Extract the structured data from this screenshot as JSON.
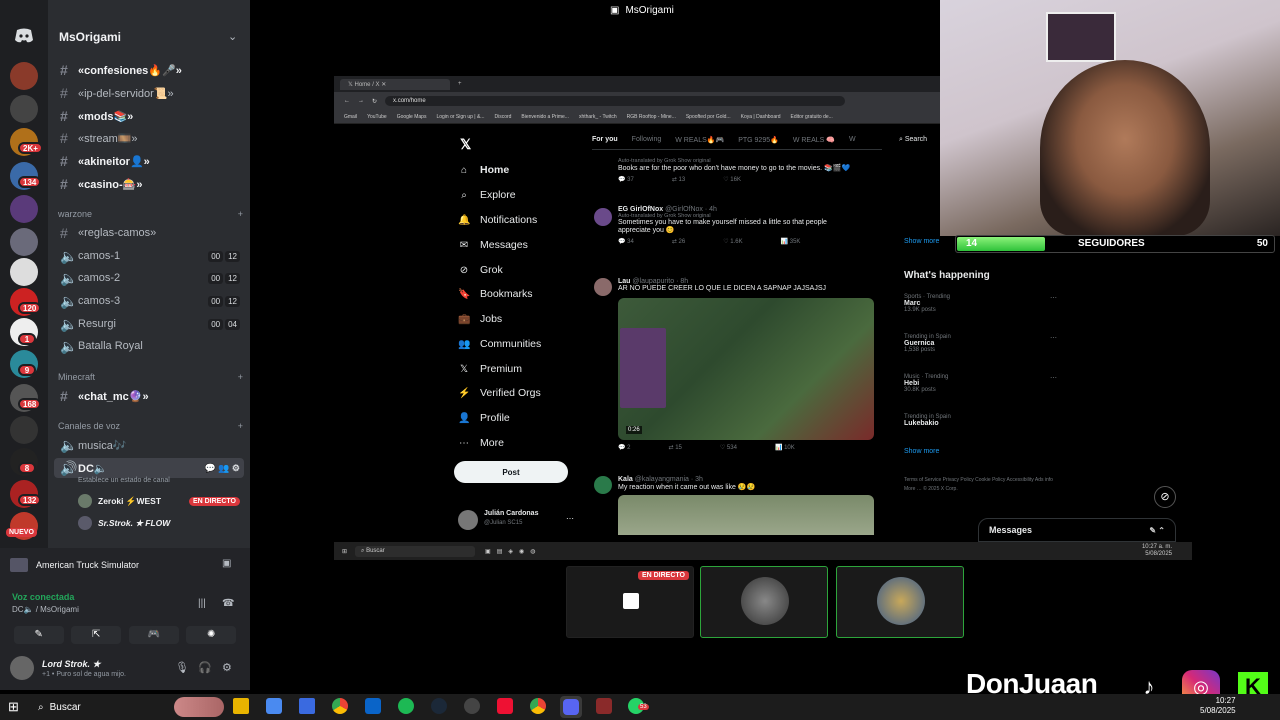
{
  "window_title": "MsOrigami",
  "discord": {
    "server_name": "MsOrigami",
    "rail_badges": [
      "2K+",
      "134",
      "120",
      "1",
      "9",
      "168",
      "8",
      "132",
      "NUEVO"
    ],
    "channels_top": [
      {
        "name": "«confesiones🔥🎤»",
        "bold": true
      },
      {
        "name": "«ip-del-servidor📜»",
        "bold": false
      },
      {
        "name": "«mods📚»",
        "bold": true
      },
      {
        "name": "«stream🎞️»",
        "bold": false
      },
      {
        "name": "«akineitor👤»",
        "bold": true
      },
      {
        "name": "«casino-🎰»",
        "bold": true
      }
    ],
    "category_warzone": "warzone",
    "warzone_channels": [
      {
        "name": "«reglas-camos»",
        "limit": [
          "",
          ""
        ]
      },
      {
        "name": "camos-1",
        "limit": [
          "00",
          "12"
        ]
      },
      {
        "name": "camos-2",
        "limit": [
          "00",
          "12"
        ]
      },
      {
        "name": "camos-3",
        "limit": [
          "00",
          "12"
        ]
      },
      {
        "name": "Resurgi",
        "limit": [
          "00",
          "04"
        ]
      },
      {
        "name": "Batalla Royal",
        "limit": [
          "",
          ""
        ]
      }
    ],
    "category_minecraft": "Minecraft",
    "minecraft_channel": "«chat_mc🔮»",
    "category_voice": "Canales de voz",
    "voice_musica": "musica🎶",
    "voice_dc": "DC🔈",
    "voice_status": "Establece un estado de canal",
    "voice_members": [
      {
        "name": "Zeroki ⚡WEST",
        "live": "EN DIRECTO"
      },
      {
        "name": "Sr.Strok. ★ FLOW",
        "live": ""
      }
    ],
    "activity": "American Truck Simulator",
    "voice_connected": "Voz conectada",
    "voice_location": "DC🔈 / MsOrigami",
    "user_name": "Lord Strok. ★",
    "user_status": "+1 • Puro sol de agua mijo."
  },
  "browser": {
    "tab_title": "Home / X",
    "url": "x.com/home",
    "bookmarks": [
      "Gmail",
      "YouTube",
      "Google Maps",
      "Login or Sign up | &...",
      "Discord",
      "Bienvenido a Prime...",
      "xhthark_ - Twitch",
      "RGB Rooftop - Mine...",
      "Spoofted por Gold...",
      "Koya | Dashboard",
      "Editor gratuito de..."
    ],
    "nav": [
      "Home",
      "Explore",
      "Notifications",
      "Messages",
      "Grok",
      "Bookmarks",
      "Jobs",
      "Communities",
      "Premium",
      "Verified Orgs",
      "Profile",
      "More"
    ],
    "post_button": "Post",
    "account_name": "Julián Cardonas",
    "account_handle": "@Julian SC15",
    "feed_tabs": [
      "For you",
      "Following",
      "W REALS🔥🎮",
      "PTG 9295🔥",
      "W REALS 🧠",
      "W"
    ],
    "tweets": [
      {
        "name": "",
        "meta": "Auto-translated by Grok Show original",
        "text": "Books are for the poor who don't have money to go to the movies. 📚🎬💙",
        "stats": [
          "37",
          "13",
          "16K"
        ]
      },
      {
        "name": "EG GirlOfNox",
        "meta": "@GirlOfNox · 4h",
        "sub": "Auto-translated by Grok Show original",
        "text": "Sometimes you have to make yourself missed a little so that people appreciate you 😊",
        "stats": [
          "34",
          "26",
          "1.6K",
          "35K"
        ]
      },
      {
        "name": "Lau",
        "meta": "@laupapurito · 8h",
        "text": "AR NO PUEDE CREER LO QUE LE DICEN A SAPNAP JAJSAJSJ",
        "stats": [
          "2",
          "15",
          "534",
          "10K"
        ],
        "video_time": "0:26"
      },
      {
        "name": "Kala",
        "meta": "@kalayangmania · 3h",
        "text": "My reaction when it came out was like 😢😢"
      }
    ],
    "search": "Search",
    "show_more": "Show more",
    "whats_happening": "What's happening",
    "trends": [
      {
        "cat": "Sports · Trending",
        "name": "Marc",
        "posts": "13.9K posts"
      },
      {
        "cat": "Trending in Spain",
        "name": "Guernica",
        "posts": "1,538 posts"
      },
      {
        "cat": "Music · Trending",
        "name": "Hebi",
        "posts": "30.8K posts"
      },
      {
        "cat": "Trending in Spain",
        "name": "Lukebakio",
        "posts": ""
      }
    ],
    "footer": "Terms of Service  Privacy Policy  Cookie Policy  Accessibility  Ads info  More …  © 2025 X Corp.",
    "messages": "Messages"
  },
  "inner_taskbar": {
    "search": "Buscar",
    "time": "10:27 a. m.",
    "date": "5/08/2025"
  },
  "stream_overlay": {
    "followers_current": "14",
    "followers_label": "SEGUIDORES",
    "followers_goal": "50",
    "followers_progress": 0.28,
    "streamer": "DonJuaan",
    "live_tile": "EN DIRECTO"
  },
  "taskbar": {
    "search": "Buscar",
    "time": "10:27",
    "date": "5/08/2025",
    "whatsapp_badge": "53"
  }
}
